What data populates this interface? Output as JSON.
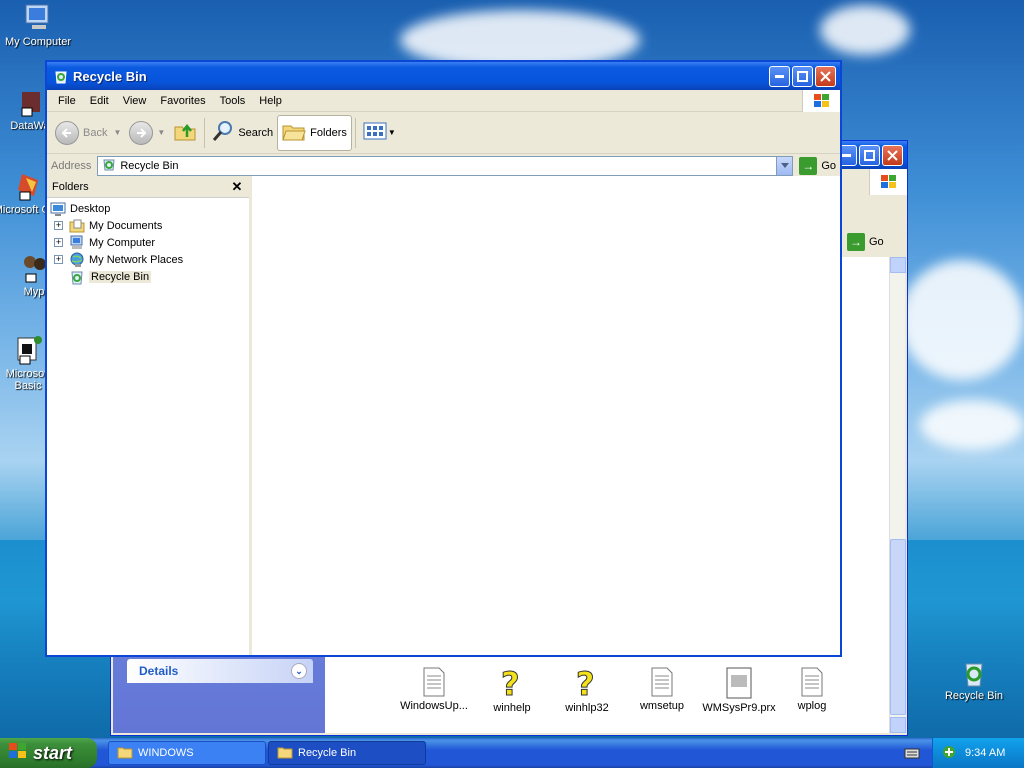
{
  "desktop": {
    "icons": [
      {
        "label": "My Computer"
      },
      {
        "label": "DataWa"
      },
      {
        "label": "Microsoft C++"
      },
      {
        "label": "Myp"
      },
      {
        "label": "Microsoft Basic"
      },
      {
        "label": "Recycle Bin"
      }
    ]
  },
  "back_window": {
    "go_label": "Go",
    "details_label": "Details",
    "files": [
      {
        "name": "WindowsUp..."
      },
      {
        "name": "winhelp"
      },
      {
        "name": "winhlp32"
      },
      {
        "name": "wmsetup"
      },
      {
        "name": "WMSysPr9.prx"
      },
      {
        "name": "wplog"
      }
    ]
  },
  "window": {
    "title": "Recycle Bin",
    "menu": [
      "File",
      "Edit",
      "View",
      "Favorites",
      "Tools",
      "Help"
    ],
    "toolbar": {
      "back": "Back",
      "search": "Search",
      "folders": "Folders"
    },
    "address": {
      "label": "Address",
      "value": "Recycle Bin",
      "go": "Go"
    },
    "folders_pane": {
      "title": "Folders",
      "tree": [
        {
          "label": "Desktop"
        },
        {
          "label": "My Documents"
        },
        {
          "label": "My Computer"
        },
        {
          "label": "My Network Places"
        },
        {
          "label": "Recycle Bin"
        }
      ]
    }
  },
  "taskbar": {
    "start": "start",
    "tasks": [
      {
        "label": "WINDOWS"
      },
      {
        "label": "Recycle Bin"
      }
    ],
    "clock": "9:34 AM"
  },
  "colors": {
    "title_blue": "#0855dd",
    "start_green": "#2d7a2c",
    "tray_blue": "#0d8bd9"
  }
}
